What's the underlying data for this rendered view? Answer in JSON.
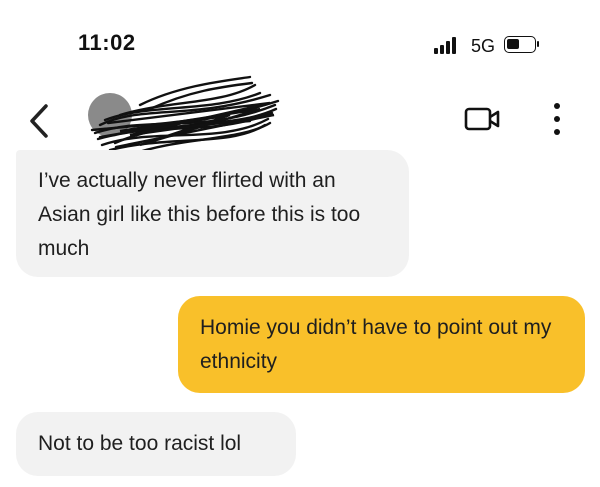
{
  "status": {
    "time": "11:02",
    "network": "5G"
  },
  "nav": {
    "back_icon": "chevron-left-icon",
    "video_icon": "video-camera-icon",
    "menu_icon": "more-vertical-icon"
  },
  "messages": [
    {
      "direction": "incoming",
      "text": "I’ve actually never flirted with an Asian girl like this before this is too much"
    },
    {
      "direction": "outgoing",
      "text": "Homie you didn’t have to point out my ethnicity"
    },
    {
      "direction": "incoming",
      "text": "Not to be too racist lol"
    }
  ],
  "colors": {
    "outgoing_bubble": "#f9c02a",
    "incoming_bubble": "#f2f2f2"
  }
}
